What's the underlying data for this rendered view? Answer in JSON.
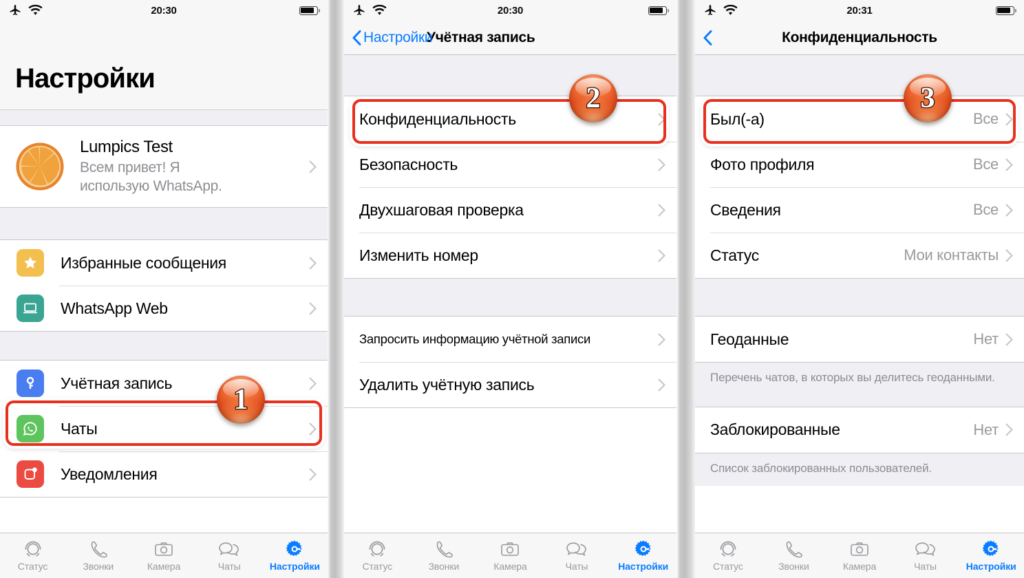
{
  "statusbar": {
    "time_a": "20:30",
    "time_b": "20:30",
    "time_c": "20:31",
    "airplane_icon": "airplane-icon",
    "wifi_icon": "wifi-icon",
    "battery_icon": "battery-icon"
  },
  "panel1": {
    "title": "Настройки",
    "profile": {
      "name": "Lumpics Test",
      "status": "Всем привет! Я использую WhatsApp.",
      "avatar_icon": "orange-slice-avatar"
    },
    "groupA": [
      {
        "label": "Избранные сообщения",
        "icon": "star-icon",
        "color": "#f3c050"
      },
      {
        "label": "WhatsApp Web",
        "icon": "laptop-icon",
        "color": "#3ba594"
      }
    ],
    "groupB": [
      {
        "label": "Учётная запись",
        "icon": "key-icon",
        "color": "#4a7ef0"
      },
      {
        "label": "Чаты",
        "icon": "whatsapp-icon",
        "color": "#5ec45e"
      },
      {
        "label": "Уведомления",
        "icon": "notification-icon",
        "color": "#ec4b42"
      }
    ]
  },
  "panel2": {
    "back_label": "Настройки",
    "title": "Учётная запись",
    "groupA": [
      {
        "label": "Конфиденциальность"
      },
      {
        "label": "Безопасность"
      },
      {
        "label": "Двухшаговая проверка"
      },
      {
        "label": "Изменить номер"
      }
    ],
    "groupB": [
      {
        "label": "Запросить информацию учётной записи",
        "small": true
      },
      {
        "label": "Удалить учётную запись"
      }
    ]
  },
  "panel3": {
    "title": "Конфиденциальность",
    "groupA": [
      {
        "label": "Был(-а)",
        "value": "Все"
      },
      {
        "label": "Фото профиля",
        "value": "Все"
      },
      {
        "label": "Сведения",
        "value": "Все"
      },
      {
        "label": "Статус",
        "value": "Мои контакты"
      }
    ],
    "groupB": [
      {
        "label": "Геоданные",
        "value": "Нет"
      }
    ],
    "footnoteB": "Перечень чатов, в которых вы делитесь геоданными.",
    "groupC": [
      {
        "label": "Заблокированные",
        "value": "Нет"
      }
    ],
    "footnoteC": "Список заблокированных пользователей."
  },
  "tabbar": {
    "items": [
      {
        "label": "Статус",
        "icon": "status-rings-icon"
      },
      {
        "label": "Звонки",
        "icon": "phone-icon"
      },
      {
        "label": "Камера",
        "icon": "camera-icon"
      },
      {
        "label": "Чаты",
        "icon": "chat-bubbles-icon"
      },
      {
        "label": "Настройки",
        "icon": "gear-icon"
      }
    ],
    "active_index": 4
  },
  "badges": {
    "one": "1",
    "two": "2",
    "three": "3"
  },
  "colors": {
    "accent": "#0a7cff",
    "highlight": "#e8301f",
    "group_bg": "#efeff4"
  }
}
